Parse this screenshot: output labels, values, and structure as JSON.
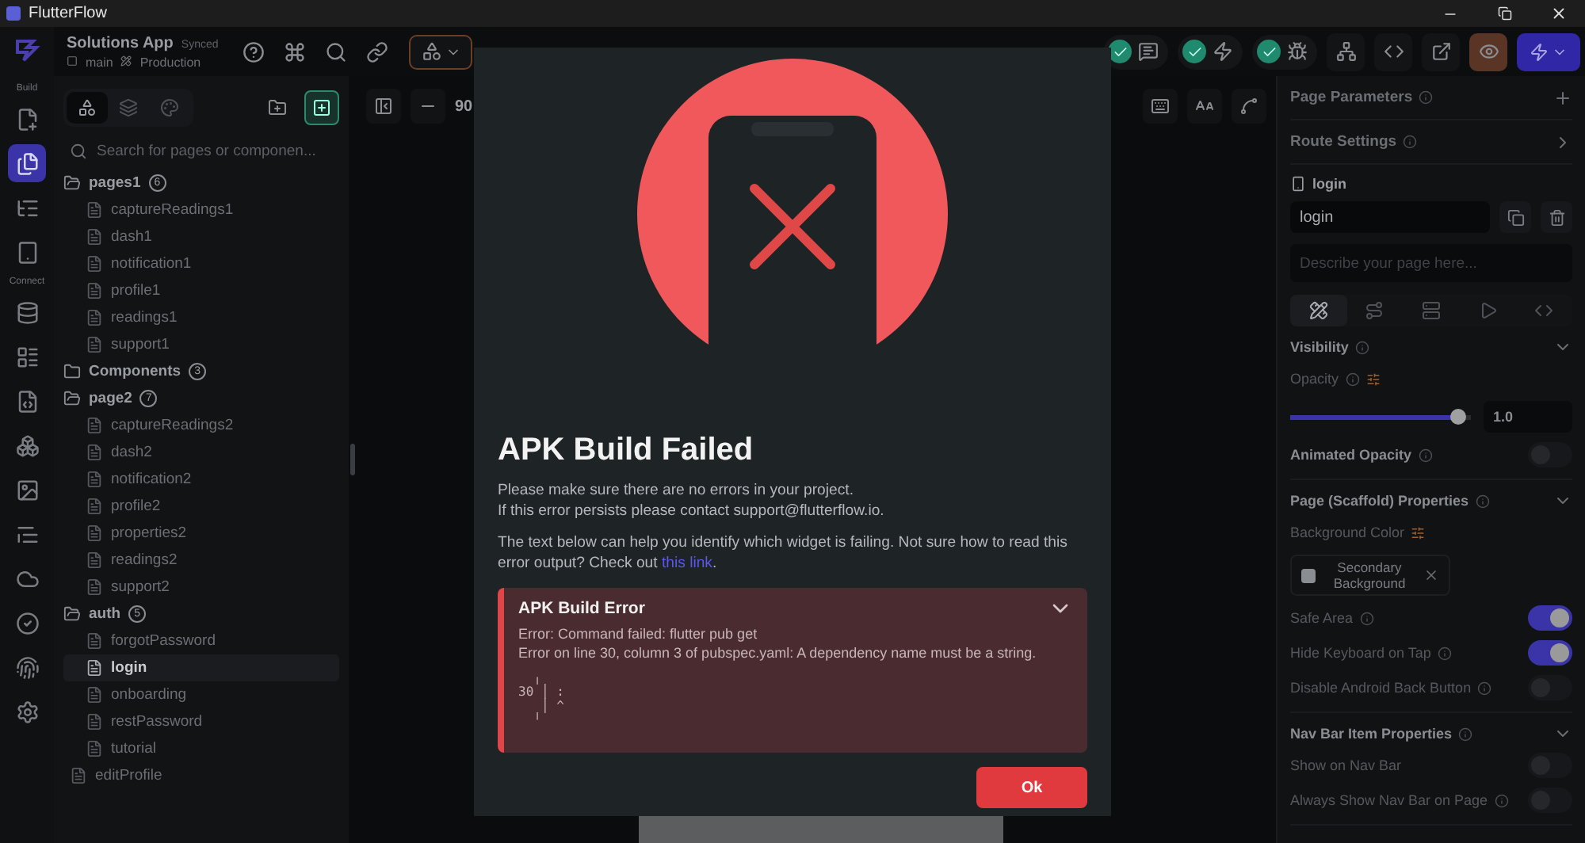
{
  "window": {
    "title": "FlutterFlow"
  },
  "toolbar": {
    "project": "Solutions App",
    "sync_status": "Synced",
    "branch": "main",
    "environment": "Production"
  },
  "rail": [
    {
      "label": "Build",
      "items": [
        {
          "kind": "add-page",
          "selected": false
        },
        {
          "kind": "pages",
          "selected": true
        },
        {
          "kind": "outline",
          "selected": false
        },
        {
          "kind": "storyboard",
          "selected": false
        }
      ]
    },
    {
      "label": "Connect",
      "items": [
        {
          "kind": "data",
          "selected": false
        },
        {
          "kind": "layout",
          "selected": false
        },
        {
          "kind": "file",
          "selected": false
        },
        {
          "kind": "components",
          "selected": false
        },
        {
          "kind": "media",
          "selected": false
        },
        {
          "kind": "list",
          "selected": false
        },
        {
          "kind": "cloud",
          "selected": false
        },
        {
          "kind": "check",
          "selected": false
        },
        {
          "kind": "fingerprint",
          "selected": false
        },
        {
          "kind": "settings",
          "selected": false
        }
      ]
    }
  ],
  "left_panel": {
    "tabs": [
      {
        "kind": "widgets",
        "selected": true
      },
      {
        "kind": "layers",
        "selected": false
      },
      {
        "kind": "theme",
        "selected": false
      }
    ],
    "search": {
      "placeholder": "Search for pages or componen..."
    },
    "tree": [
      {
        "label": "pages1",
        "count": "6",
        "expanded": true,
        "children": [
          {
            "label": "captureReadings1",
            "selected": false
          },
          {
            "label": "dash1",
            "selected": false
          },
          {
            "label": "notification1",
            "selected": false
          },
          {
            "label": "profile1",
            "selected": false
          },
          {
            "label": "readings1",
            "selected": false
          },
          {
            "label": "support1",
            "selected": false
          }
        ]
      },
      {
        "label": "Components",
        "count": "3",
        "expanded": false
      },
      {
        "label": "page2",
        "count": "7",
        "expanded": true,
        "children": [
          {
            "label": "captureReadings2",
            "selected": false
          },
          {
            "label": "dash2",
            "selected": false
          },
          {
            "label": "notification2",
            "selected": false
          },
          {
            "label": "profile2",
            "selected": false
          },
          {
            "label": "properties2",
            "selected": false
          },
          {
            "label": "readings2",
            "selected": false
          },
          {
            "label": "support2",
            "selected": false
          }
        ]
      },
      {
        "label": "auth",
        "count": "5",
        "expanded": true,
        "children": [
          {
            "label": "forgotPassword",
            "selected": false
          },
          {
            "label": "login",
            "selected": true
          },
          {
            "label": "onboarding",
            "selected": false
          },
          {
            "label": "restPassword",
            "selected": false
          },
          {
            "label": "tutorial",
            "selected": false
          }
        ]
      },
      {
        "label": "editProfile",
        "selected": false
      }
    ]
  },
  "canvas": {
    "zoom": "90"
  },
  "right_panel": {
    "headers": [
      {
        "label": "Page Parameters",
        "kind": "add"
      },
      {
        "label": "Route Settings",
        "kind": "open"
      }
    ],
    "page_label": "login",
    "page_name": "login",
    "description": {
      "placeholder": "Describe your page here..."
    },
    "tabs": [
      {
        "kind": "properties",
        "selected": true
      },
      {
        "kind": "actions",
        "selected": false
      },
      {
        "kind": "backend",
        "selected": false
      },
      {
        "kind": "play",
        "selected": false
      },
      {
        "kind": "code",
        "selected": false
      }
    ],
    "sections": [
      {
        "title": "Visibility",
        "expanded": true,
        "rows": [
          {
            "kind": "slider",
            "label": "Opacity",
            "info": true,
            "level": 0.93,
            "value": "1.0"
          },
          {
            "kind": "toggle",
            "label": "Animated Opacity",
            "info": true,
            "on": false,
            "strong": true
          }
        ]
      },
      {
        "title": "Page (Scaffold) Properties",
        "expanded": true,
        "rows": [
          {
            "kind": "color",
            "label": "Background Color",
            "value": "Secondary Background",
            "info": false
          },
          {
            "kind": "toggle",
            "label": "Safe Area",
            "info": true,
            "on": true
          },
          {
            "kind": "toggle",
            "label": "Hide Keyboard on Tap",
            "info": true,
            "on": true
          },
          {
            "kind": "toggle",
            "label": "Disable Android Back Button",
            "info": true,
            "on": false
          }
        ]
      },
      {
        "title": "Nav Bar Item Properties",
        "expanded": true,
        "rows": [
          {
            "kind": "toggle",
            "label": "Show on Nav Bar",
            "info": false,
            "on": false
          },
          {
            "kind": "toggle",
            "label": "Always Show Nav Bar on Page",
            "info": true,
            "on": false
          }
        ]
      }
    ]
  },
  "dialog": {
    "title": "APK Build Failed",
    "message_lines": [
      "Please make sure there are no errors in your project.",
      "If this error persists please contact support@flutterflow.io."
    ],
    "help_text": "The text below can help you identify which widget is failing. Not sure how to read this error output? Check out",
    "help_link": "this link",
    "help_end": ".",
    "error": {
      "title": "APK Build Error",
      "expanded": true,
      "lines": [
        "Error: Command failed: flutter pub get",
        "Error on line 30, column 3 of pubspec.yaml: A dependency name must be a string."
      ],
      "code": [
        "  ╷",
        "30 │ :",
        "   │ ^",
        "  ╵"
      ]
    },
    "ok": "Ok"
  }
}
